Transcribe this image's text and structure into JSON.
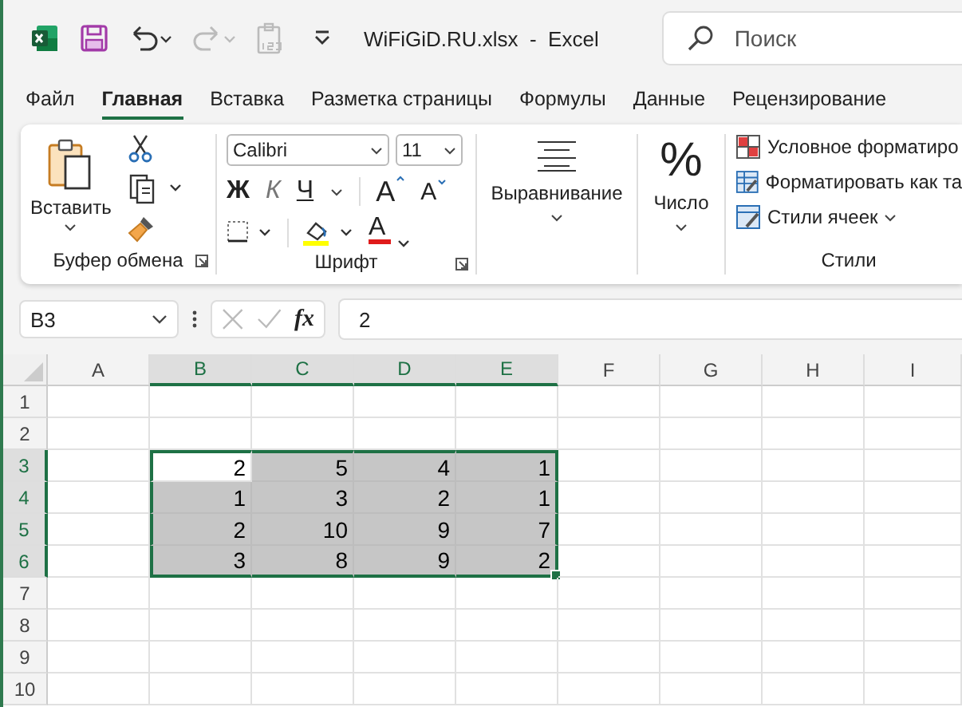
{
  "title_bar": {
    "filename": "WiFiGiD.RU.xlsx",
    "separator": "-",
    "app": "Excel",
    "search": {
      "placeholder": "Поиск"
    }
  },
  "tabs": [
    {
      "label": "Файл",
      "selected": false
    },
    {
      "label": "Главная",
      "selected": true
    },
    {
      "label": "Вставка",
      "selected": false
    },
    {
      "label": "Разметка страницы",
      "selected": false
    },
    {
      "label": "Формулы",
      "selected": false
    },
    {
      "label": "Данные",
      "selected": false
    },
    {
      "label": "Рецензирование",
      "selected": false
    }
  ],
  "ribbon": {
    "clipboard": {
      "paste_label": "Вставить",
      "group_label": "Буфер обмена"
    },
    "font": {
      "font_name": "Calibri",
      "font_size": "11",
      "bold": "Ж",
      "italic": "К",
      "underline": "Ч",
      "grow": "A",
      "shrink": "A",
      "font_color": "A",
      "group_label": "Шрифт"
    },
    "alignment": {
      "label": "Выравнивание"
    },
    "number": {
      "symbol": "%",
      "label": "Число"
    },
    "styles": {
      "items": [
        {
          "label": "Условное форматиро",
          "kind": "conditional"
        },
        {
          "label": "Форматировать как та",
          "kind": "table"
        },
        {
          "label": "Стили ячеек",
          "kind": "cell"
        }
      ],
      "group_label": "Стили"
    }
  },
  "formula_bar": {
    "name_box": "B3",
    "fx": "fx",
    "value": "2"
  },
  "sheet": {
    "columns": [
      {
        "label": "A",
        "selected": false
      },
      {
        "label": "B",
        "selected": true
      },
      {
        "label": "C",
        "selected": true
      },
      {
        "label": "D",
        "selected": true
      },
      {
        "label": "E",
        "selected": true
      },
      {
        "label": "F",
        "selected": false
      },
      {
        "label": "G",
        "selected": false
      },
      {
        "label": "H",
        "selected": false
      },
      {
        "label": "I",
        "selected": false
      }
    ],
    "rows": [
      {
        "label": "1",
        "selected": false,
        "cells": []
      },
      {
        "label": "2",
        "selected": false,
        "cells": []
      },
      {
        "label": "3",
        "selected": true,
        "cells": [
          {
            "selected": false
          },
          {
            "value": "2",
            "selected": true,
            "active": true
          },
          {
            "value": "5",
            "selected": true,
            "active": false
          },
          {
            "value": "4",
            "selected": true,
            "active": false
          },
          {
            "value": "1",
            "selected": true,
            "active": false
          }
        ]
      },
      {
        "label": "4",
        "selected": true,
        "cells": [
          {
            "selected": false
          },
          {
            "value": "1",
            "selected": true,
            "active": false
          },
          {
            "value": "3",
            "selected": true,
            "active": false
          },
          {
            "value": "2",
            "selected": true,
            "active": false
          },
          {
            "value": "1",
            "selected": true,
            "active": false
          }
        ]
      },
      {
        "label": "5",
        "selected": true,
        "cells": [
          {
            "selected": false
          },
          {
            "value": "2",
            "selected": true,
            "active": false
          },
          {
            "value": "10",
            "selected": true,
            "active": false
          },
          {
            "value": "9",
            "selected": true,
            "active": false
          },
          {
            "value": "7",
            "selected": true,
            "active": false
          }
        ]
      },
      {
        "label": "6",
        "selected": true,
        "cells": [
          {
            "selected": false
          },
          {
            "value": "3",
            "selected": true,
            "active": false
          },
          {
            "value": "8",
            "selected": true,
            "active": false
          },
          {
            "value": "9",
            "selected": true,
            "active": false
          },
          {
            "value": "2",
            "selected": true,
            "active": false
          }
        ]
      },
      {
        "label": "7",
        "selected": false,
        "cells": []
      },
      {
        "label": "8",
        "selected": false,
        "cells": []
      },
      {
        "label": "9",
        "selected": false,
        "cells": []
      },
      {
        "label": "10",
        "selected": false,
        "cells": []
      }
    ]
  }
}
